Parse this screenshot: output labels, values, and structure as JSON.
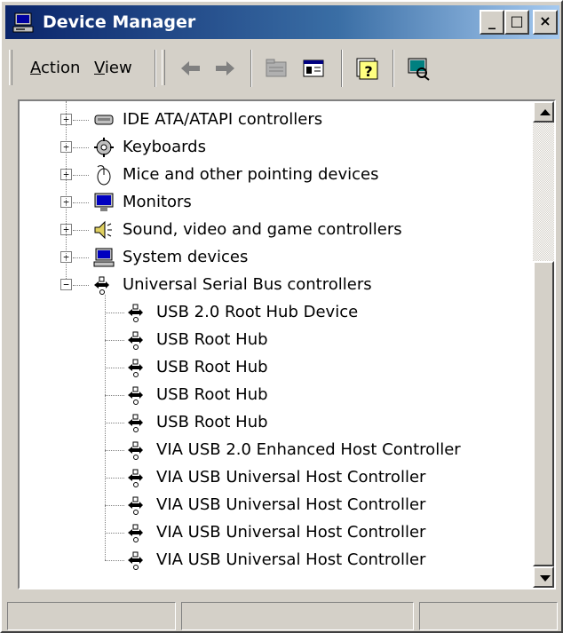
{
  "window": {
    "title": "Device Manager",
    "title_icon": "computer-icon",
    "controls": {
      "minimize": "_",
      "maximize": "□",
      "close": "×"
    }
  },
  "menu": {
    "action": {
      "label": "Action",
      "accel": "A"
    },
    "view": {
      "label": "View",
      "accel": "V"
    }
  },
  "toolbar": {
    "buttons": [
      {
        "icon": "back-arrow-icon"
      },
      {
        "icon": "forward-arrow-icon"
      },
      {
        "icon": "folder-view-icon"
      },
      {
        "icon": "properties-icon"
      },
      {
        "icon": "help-icon"
      },
      {
        "icon": "scan-hardware-icon"
      }
    ]
  },
  "tree": {
    "categories": [
      {
        "label": "IDE ATA/ATAPI controllers",
        "expanded": false,
        "icon": "ide-controller-icon"
      },
      {
        "label": "Keyboards",
        "expanded": false,
        "icon": "keyboard-icon"
      },
      {
        "label": "Mice and other pointing devices",
        "expanded": false,
        "icon": "mouse-icon"
      },
      {
        "label": "Monitors",
        "expanded": false,
        "icon": "monitor-icon"
      },
      {
        "label": "Sound, video and game controllers",
        "expanded": false,
        "icon": "sound-icon"
      },
      {
        "label": "System devices",
        "expanded": false,
        "icon": "system-devices-icon"
      },
      {
        "label": "Universal Serial Bus controllers",
        "expanded": true,
        "icon": "usb-icon"
      }
    ],
    "usb_children": [
      "USB 2.0 Root Hub Device",
      "USB Root Hub",
      "USB Root Hub",
      "USB Root Hub",
      "USB Root Hub",
      "VIA USB 2.0 Enhanced Host Controller",
      "VIA USB Universal Host Controller",
      "VIA USB Universal Host Controller",
      "VIA USB Universal Host Controller",
      "VIA USB Universal Host Controller"
    ],
    "expander_collapsed": "+",
    "expander_expanded": "−"
  },
  "colors": {
    "titlebar_start": "#0a246a",
    "titlebar_end": "#a6caf0",
    "face": "#d4d0c8"
  }
}
